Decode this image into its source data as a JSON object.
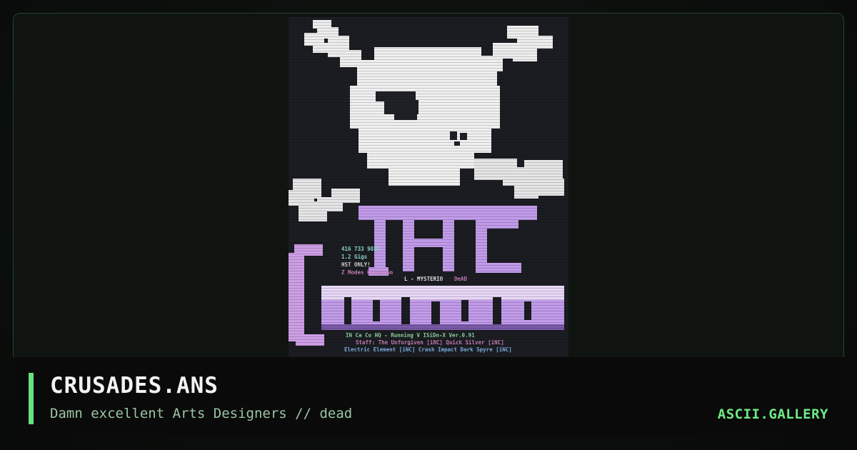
{
  "artwork": {
    "info_lines": [
      {
        "text": "416 733 9880",
        "color": "#8fd6d2"
      },
      {
        "text": "1.2 Gigs",
        "color": "#8fd6d2"
      },
      {
        "text": "HST ONLY!",
        "color": "#d9d9d9"
      },
      {
        "text": "Z Modes Kingdown",
        "color": "#c77fb5"
      }
    ],
    "mysterio_line": "L - MYSTERIO",
    "dead_word": "DeAD",
    "running_line": "IN Ca       Co      HQ -  Running V ISiDn-X Ver.0.91",
    "staff_line": "Staff: The Unforgiven [iNC] Quick Silver [iNC]",
    "elements_line": "Electric Element [iNC] Crash Impact Dark Spyre [iNC]"
  },
  "card": {
    "title": "CRUSADES.ANS",
    "subtitle": "Damn excellent Arts Designers // dead",
    "brand": "ASCII.GALLERY"
  },
  "colors": {
    "accent": "#66e27f",
    "title": "#f2f4f3",
    "subtitle": "#9cc5a5",
    "brand": "#6fea86",
    "art_purple": "#c29bea",
    "art_white": "#f1f1f1"
  }
}
